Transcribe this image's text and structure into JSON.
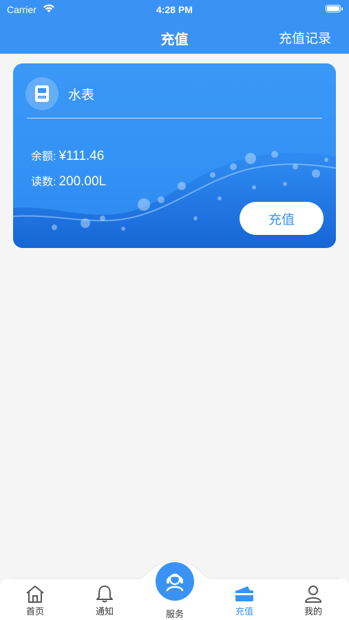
{
  "status_bar": {
    "carrier": "Carrier",
    "time": "4:28 PM"
  },
  "nav": {
    "title": "充值",
    "right_action": "充值记录"
  },
  "card": {
    "meter_name": "水表",
    "balance_label": "余额:",
    "balance_value": "¥111.46",
    "reading_label": "读数:",
    "reading_value": "200.00L",
    "recharge_button": "充值"
  },
  "tabbar": {
    "items": [
      {
        "label": "首页",
        "icon": "home-icon",
        "active": false
      },
      {
        "label": "通知",
        "icon": "bell-icon",
        "active": false
      },
      {
        "label": "服务",
        "icon": "customer-service-icon",
        "active": false
      },
      {
        "label": "充值",
        "icon": "wallet-card-icon",
        "active": true
      },
      {
        "label": "我的",
        "icon": "user-icon",
        "active": false
      }
    ]
  },
  "colors": {
    "primary": "#3a93f4",
    "background": "#f5f5f5",
    "text": "#333333"
  }
}
